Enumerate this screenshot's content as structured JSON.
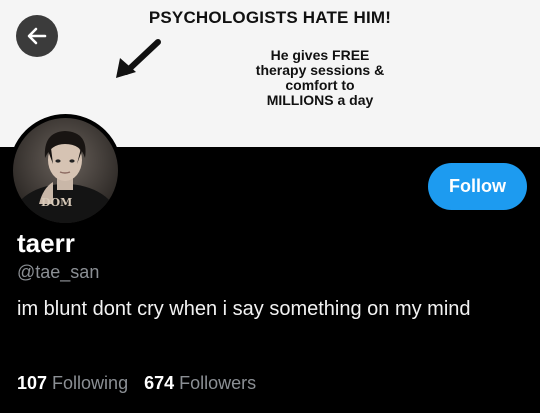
{
  "banner": {
    "headline": "PSYCHOLOGISTS HATE HIM!",
    "body_lines": [
      "He gives FREE",
      "therapy sessions &",
      "comfort to",
      "MILLIONS a day"
    ]
  },
  "header": {
    "back_icon": "arrow-left-icon"
  },
  "profile": {
    "avatar_text": "DOM",
    "display_name": "taerr",
    "handle": "@tae_san",
    "bio": "im blunt dont cry when i say something on my mind",
    "follow_label": "Follow"
  },
  "stats": {
    "following_count": "107",
    "following_label": "Following",
    "followers_count": "674",
    "followers_label": "Followers"
  },
  "colors": {
    "accent": "#1d9bf0",
    "background": "#000000",
    "muted_text": "#8b8f94"
  }
}
